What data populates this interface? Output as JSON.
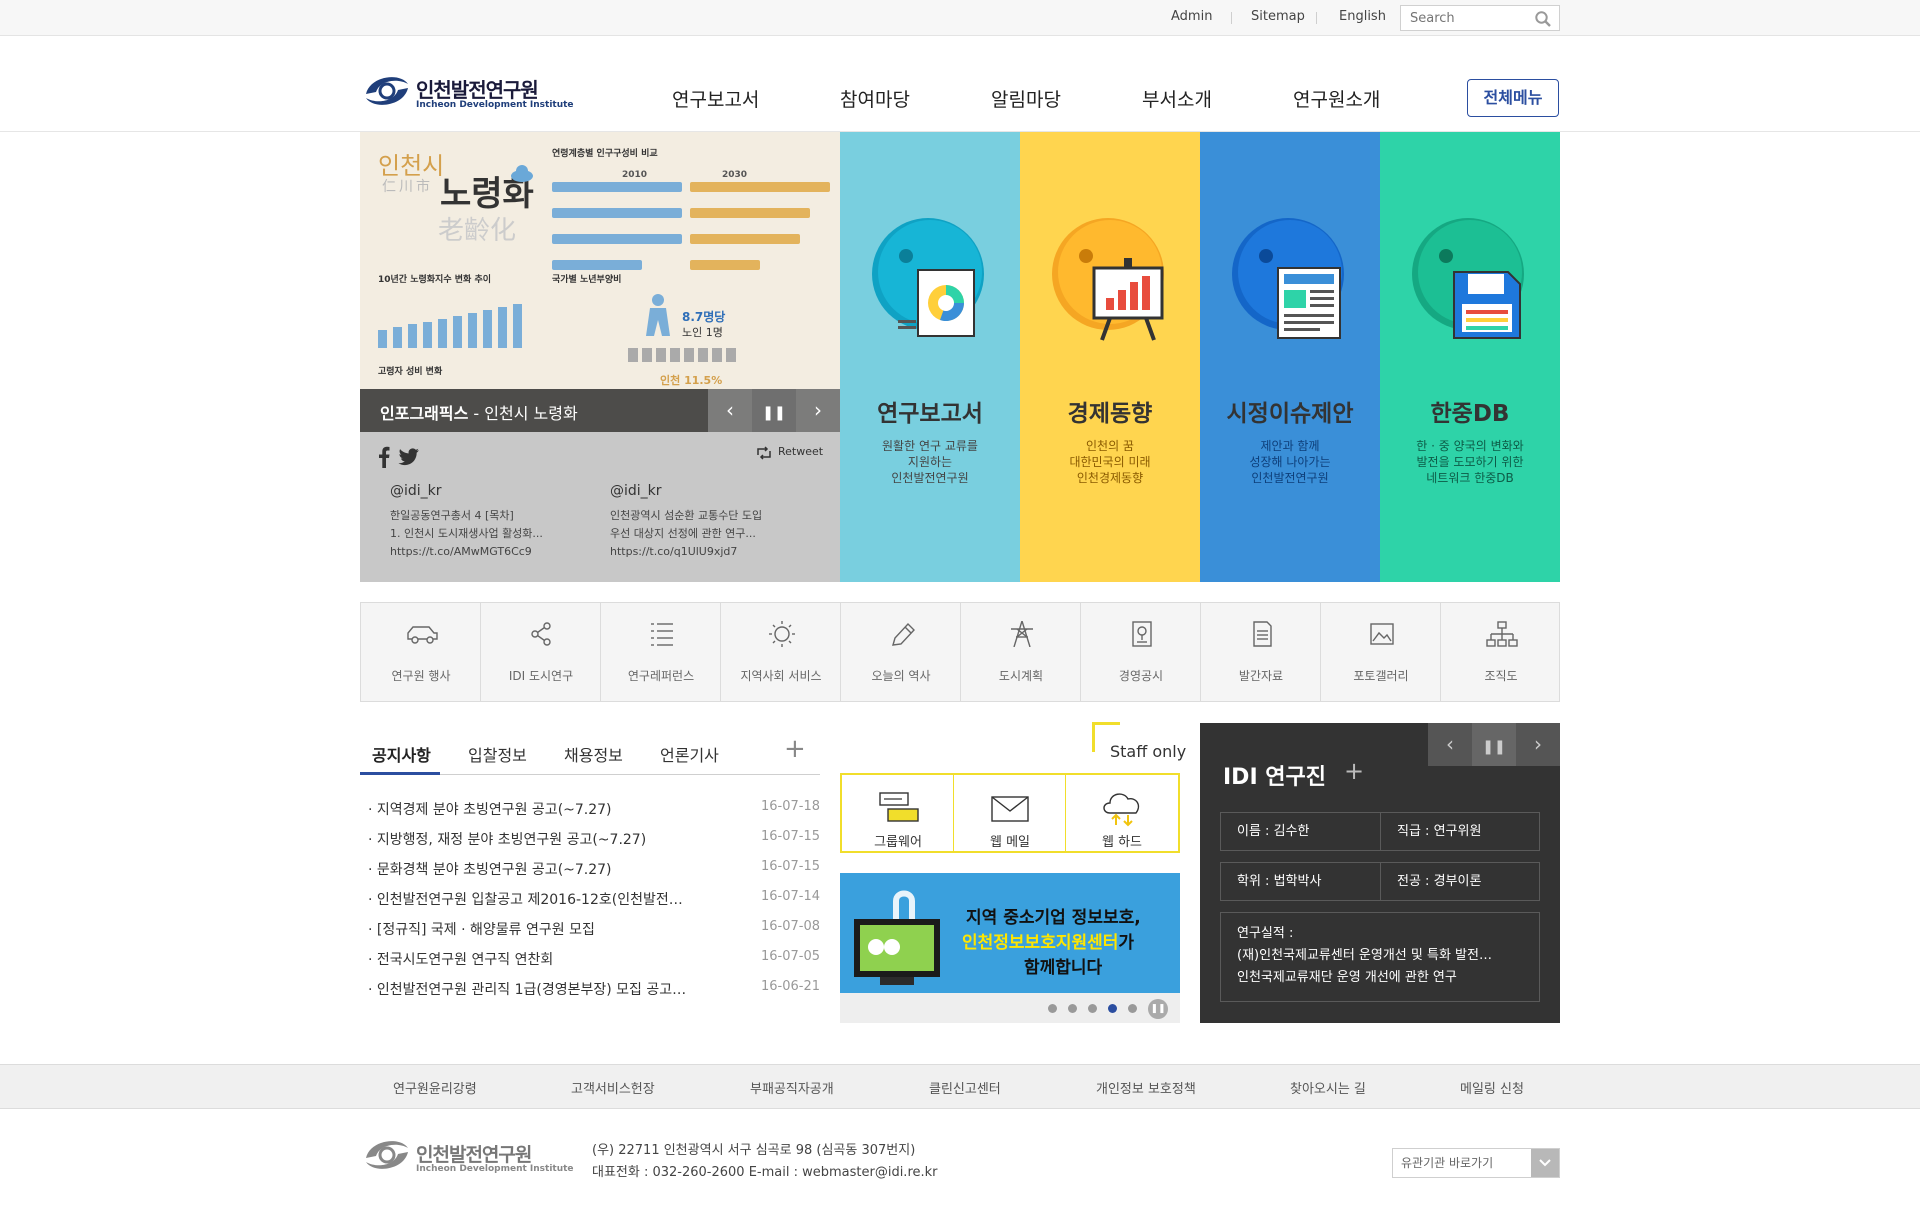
{
  "top_links": {
    "admin": "Admin",
    "sitemap": "Sitemap",
    "english": "English",
    "search_placeholder": "Search"
  },
  "logo": {
    "name": "인천발전연구원",
    "sub": "Incheon Development Institute"
  },
  "nav": [
    "연구보고서",
    "참여마당",
    "알림마당",
    "부서소개",
    "연구원소개"
  ],
  "all_menu": "전체메뉴",
  "hero": {
    "caption_bold": "인포그래픽스",
    "caption_rest": " - 인천시 노령화",
    "poster": {
      "city": "인천시",
      "hanja_city": "仁川市",
      "title": "노령화",
      "hanja_title": "老齡化",
      "chart1_title": "연령계층별 인구구성비 비교",
      "chart1_years": [
        "2010",
        "2030"
      ],
      "chart2_title": "10년간 노령화지수 변화 추이",
      "chart3_title": "국가별 노년부양비",
      "chart4_title": "고령자 성비 변화",
      "stat1": "8.7명당",
      "stat2": "노인 1명",
      "stat3": "인천 11.5%"
    }
  },
  "social": {
    "retweet": "Retweet",
    "tweets": [
      {
        "handle": "@idi_kr",
        "line1": "한일공동연구총서 4 [목차]",
        "line2": "1. 인천시 도시재생사업 활성화...",
        "line3": "https://t.co/AMwMGT6Cc9"
      },
      {
        "handle": "@idi_kr",
        "line1": "인천광역시 섬순환 교통수단 도입",
        "line2": "우선 대상지 선정에 관한 연구...",
        "line3": "https://t.co/q1UlU9xjd7"
      }
    ]
  },
  "panels": [
    {
      "title": "연구보고서",
      "desc": [
        "원활한 연구 교류를",
        "지원하는",
        "인천발전연구원"
      ]
    },
    {
      "title": "경제동향",
      "desc": [
        "인천의 꿈",
        "대한민국의 미래",
        "인천경제동향"
      ]
    },
    {
      "title": "시정이슈제안",
      "desc": [
        "제안과 함께",
        "성장해 나아가는",
        "인천발전연구원"
      ]
    },
    {
      "title": "한중DB",
      "desc": [
        "한 · 중 양국의 변화와",
        "발전을 도모하기 위한",
        "네트워크 한중DB"
      ]
    }
  ],
  "panel_colors": [
    "#79cfdf",
    "#ffd54f",
    "#3a8fd8",
    "#2ed3a8"
  ],
  "quick_links": [
    "연구원 행사",
    "IDI 도시연구",
    "연구레퍼런스",
    "지역사회 서비스",
    "오늘의 역사",
    "도시계획",
    "경영공시",
    "발간자료",
    "포토갤러리",
    "조직도"
  ],
  "notice_tabs": [
    "공지사항",
    "입찰정보",
    "채용정보",
    "언론기사"
  ],
  "notices": [
    {
      "title": "· 지역경제 분야 초빙연구원 공고(~7.27)",
      "date": "16-07-18"
    },
    {
      "title": "· 지방행정, 재정 분야 초빙연구원 공고(~7.27)",
      "date": "16-07-15"
    },
    {
      "title": "· 문화경책 분야 초빙연구원 공고(~7.27)",
      "date": "16-07-15"
    },
    {
      "title": "· 인천발전연구원 입찰공고 제2016-12호(인천발전…",
      "date": "16-07-14"
    },
    {
      "title": "· [정규직] 국제 · 해양물류 연구원 모집",
      "date": "16-07-08"
    },
    {
      "title": "· 전국시도연구원 연구직 연찬회",
      "date": "16-07-05"
    },
    {
      "title": "· 인천발전연구원 관리직 1급(경영본부장) 모집 공고…",
      "date": "16-06-21"
    }
  ],
  "staff": {
    "label": "Staff only",
    "items": [
      "그룹웨어",
      "웹 메일",
      "웹 하드"
    ]
  },
  "banner": {
    "line1": "지역 중소기업 정보보호,",
    "line2_highlight": "인천정보보호지원센터",
    "line2_rest": "가",
    "line3": "함께합니다"
  },
  "researcher": {
    "title": "IDI 연구진",
    "name": "이름 : 김수한",
    "position": "직급 : 연구위원",
    "degree": "학위 : 법학박사",
    "major": "전공 : 경부이론",
    "achievements_label": "연구실적 :",
    "achievements": [
      "(재)인천국제교류센터 운영개선 및 특화 발전…",
      "인천국제교류재단 운영 개선에 관한 연구"
    ]
  },
  "footer_links": [
    "연구원윤리강령",
    "고객서비스헌장",
    "부패공직자공개",
    "클린신고센터",
    "개인정보 보호정책",
    "찾아오시는 길",
    "메일링 신청"
  ],
  "footer": {
    "address": "(우) 22711  인천광역시 서구 심곡로 98 (심곡동 307번지)",
    "contact": "대표전화 : 032-260-2600  E-mail : webmaster@idi.re.kr",
    "related": "유관기관 바로가기"
  },
  "colors": {
    "brand_blue": "#2b4ea0",
    "staff_yellow": "#f1de2b"
  }
}
